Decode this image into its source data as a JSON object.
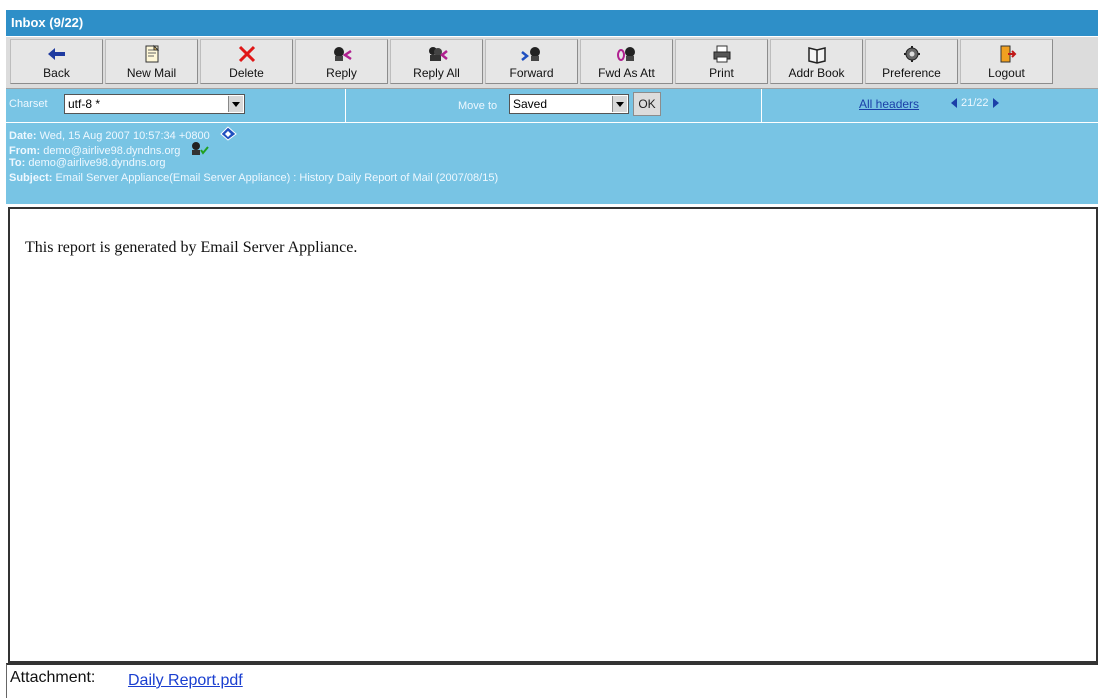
{
  "window": {
    "title": "Inbox (9/22)"
  },
  "toolbar": {
    "buttons": [
      {
        "label": "Back",
        "icon": "back-arrow-icon"
      },
      {
        "label": "New Mail",
        "icon": "new-mail-icon"
      },
      {
        "label": "Delete",
        "icon": "delete-x-icon"
      },
      {
        "label": "Reply",
        "icon": "reply-icon"
      },
      {
        "label": "Reply All",
        "icon": "reply-all-icon"
      },
      {
        "label": "Forward",
        "icon": "forward-icon"
      },
      {
        "label": "Fwd As Att",
        "icon": "forward-as-attachment-icon"
      },
      {
        "label": "Print",
        "icon": "print-icon"
      },
      {
        "label": "Addr Book",
        "icon": "address-book-icon"
      },
      {
        "label": "Preference",
        "icon": "preference-icon"
      },
      {
        "label": "Logout",
        "icon": "logout-icon"
      }
    ]
  },
  "options": {
    "charset_label": "Charset",
    "charset_value": "utf-8 *",
    "move_to_label": "Move to",
    "move_to_value": "Saved",
    "ok_label": "OK",
    "all_headers_label": "All headers",
    "pager_text": "21/22"
  },
  "header": {
    "date_key": "Date:",
    "date_value": "Wed, 15 Aug 2007 10:57:34 +0800",
    "from_key": "From:",
    "from_value": "demo@airlive98.dyndns.org",
    "to_key": "To:",
    "to_value": "demo@airlive98.dyndns.org",
    "subject_key": "Subject:",
    "subject_value": "Email Server Appliance(Email Server Appliance) : History Daily Report of Mail (2007/08/15)"
  },
  "body": {
    "text": "This report is generated by Email Server Appliance."
  },
  "attachment": {
    "label": "Attachment:",
    "file_name": "Daily Report.pdf"
  },
  "colors": {
    "titlebar": "#2e8fc8",
    "header_panel": "#78c4e4",
    "link": "#1a3fd0"
  }
}
